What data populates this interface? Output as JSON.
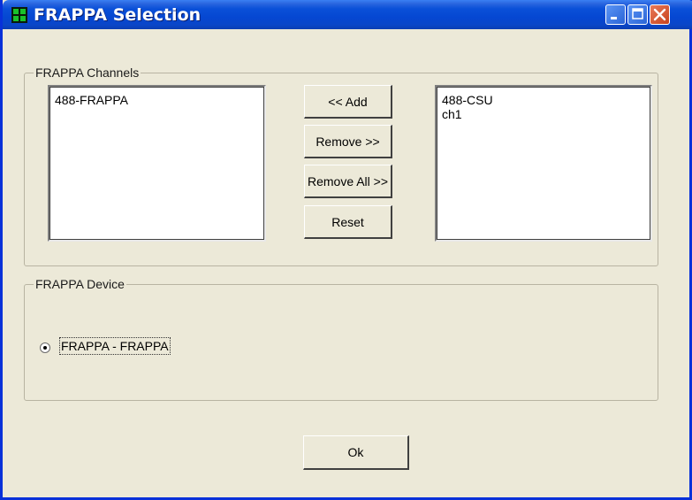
{
  "window": {
    "title": "FRAPPA Selection"
  },
  "channels_group": {
    "title": "FRAPPA Channels",
    "available": [
      "488-FRAPPA"
    ],
    "selected": [
      "488-CSU",
      "ch1"
    ],
    "buttons": {
      "add": "<< Add",
      "remove": "Remove >>",
      "remove_all": "Remove All >>",
      "reset": "Reset"
    }
  },
  "device_group": {
    "title": "FRAPPA Device",
    "option_label": "FRAPPA - FRAPPA",
    "option_selected": true
  },
  "footer": {
    "ok": "Ok"
  },
  "icons": [
    "app-icon",
    "minimize-icon",
    "maximize-icon",
    "close-icon"
  ]
}
